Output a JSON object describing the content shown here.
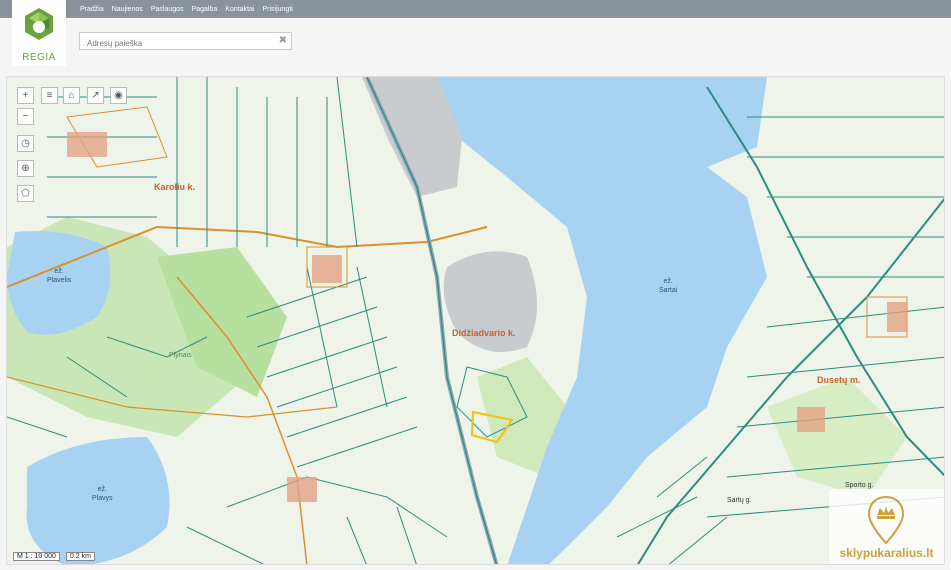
{
  "app": {
    "logo_text": "REGIA"
  },
  "nav": {
    "items": [
      "Pradžia",
      "Naujienos",
      "Paslaugos",
      "Pagalba",
      "Kontaktai",
      "Prisijungti"
    ]
  },
  "search": {
    "placeholder": "Adresų paieška",
    "value": ""
  },
  "map": {
    "labels": {
      "karoliu": "Karoliu k.",
      "plaveliu": "ež.\nPlavelis",
      "sartai": "ež.\nSartai",
      "plavys": "ež.\nPlavys",
      "didziadvario": "Didžiadvario k.",
      "dusetu": "Dusetų m.",
      "plynais": "Plynais",
      "road1": "Sartų g.",
      "road2": "Sporto g."
    },
    "scale_text": "M 1 : 10 000",
    "distance_text": "0.2 km",
    "watermark": "sklypukaralius.lt"
  },
  "colors": {
    "water": "#a8d2f2",
    "parcel": "#2e8b82",
    "road": "#d9912f",
    "forest": "#c8e6b4",
    "topbar": "#8a939b"
  }
}
